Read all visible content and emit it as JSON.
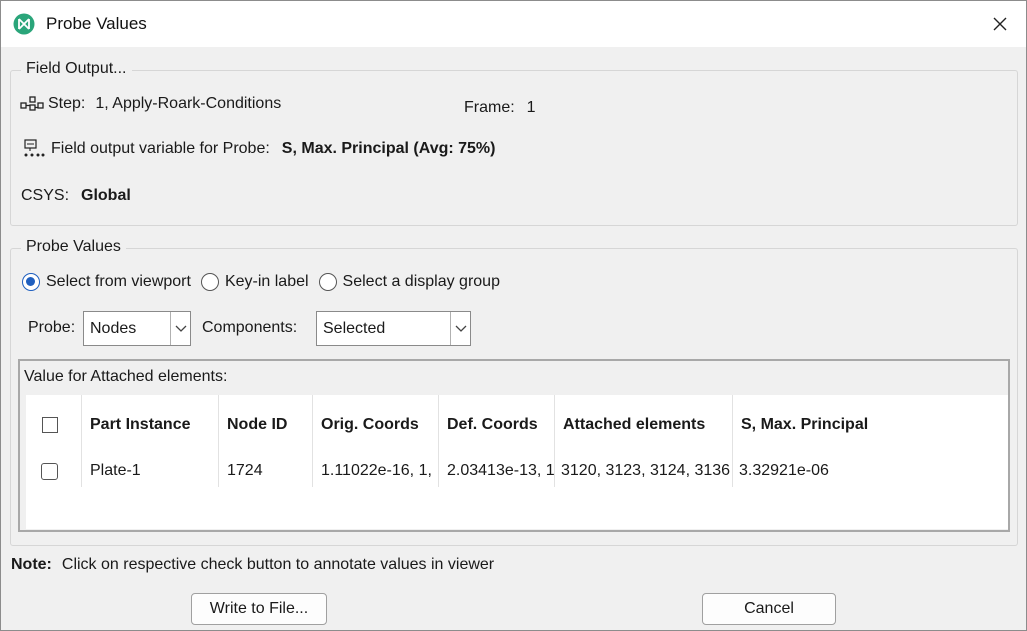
{
  "window": {
    "title": "Probe Values",
    "app_icon": "abaqus-logo-icon",
    "accent_color": "#2aa57a"
  },
  "field_output": {
    "legend": "Field Output...",
    "step_label": "Step:",
    "step_value": "1, Apply-Roark-Conditions",
    "frame_label": "Frame:",
    "frame_value": "1",
    "variable_label": "Field output variable for Probe:",
    "variable_value": "S, Max. Principal (Avg: 75%)",
    "csys_label": "CSYS:",
    "csys_value": "Global"
  },
  "probe_values": {
    "legend": "Probe Values",
    "radio_options": [
      {
        "label": "Select from viewport",
        "checked": true
      },
      {
        "label": "Key-in label",
        "checked": false
      },
      {
        "label": "Select a display group",
        "checked": false
      }
    ],
    "probe_label": "Probe:",
    "probe_selected": "Nodes",
    "components_label": "Components:",
    "components_selected": "Selected"
  },
  "table": {
    "caption": "Value for Attached elements:",
    "columns": [
      "Part Instance",
      "Node ID",
      "Orig. Coords",
      "Def. Coords",
      "Attached elements",
      "S, Max. Principal"
    ],
    "rows": [
      {
        "checked": false,
        "cells": [
          "Plate-1",
          "1724",
          "1.11022e-16, 1,",
          "2.03413e-13, 1",
          "3120, 3123, 3124, 3136",
          "3.32921e-06"
        ]
      }
    ]
  },
  "note": {
    "label": "Note:",
    "text": "Click on respective check button to annotate values in viewer"
  },
  "buttons": {
    "write": "Write to File...",
    "cancel": "Cancel"
  }
}
